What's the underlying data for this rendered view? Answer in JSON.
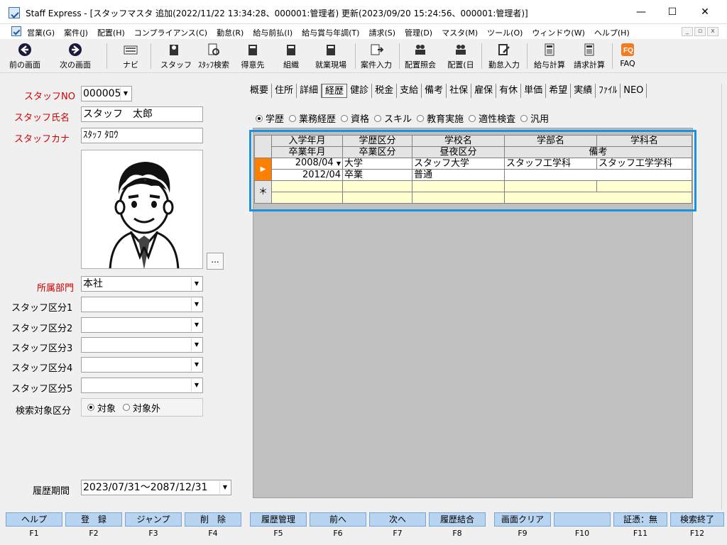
{
  "window": {
    "title": "Staff Express - [スタッフマスタ 追加(2022/11/22 13:34:28、000001:管理者) 更新(2023/09/20 15:24:56、000001:管理者)]",
    "minimize": "—",
    "maximize": "☐",
    "close": "✕"
  },
  "menu": [
    "営業(G)",
    "案件(J)",
    "配置(H)",
    "コンプライアンス(C)",
    "勤怠(R)",
    "給与前払(I)",
    "給与賞与年調(T)",
    "請求(S)",
    "管理(D)",
    "マスタ(M)",
    "ツール(O)",
    "ウィンドウ(W)",
    "ヘルプ(H)"
  ],
  "toolbar": {
    "back": "前の画面",
    "next": "次の画面",
    "navi": "ナビ",
    "staff": "スタッフ",
    "staff_search": "ｽﾀｯﾌ検索",
    "client": "得意先",
    "org": "組織",
    "site": "就業現場",
    "case_input": "案件入力",
    "placement_inquiry": "配置照会",
    "placement_day": "配置(日",
    "attendance_input": "勤怠入力",
    "payroll_calc": "給与計算",
    "billing_calc": "請求計算",
    "faq": "FAQ"
  },
  "left": {
    "staff_no_label": "スタッフNO",
    "staff_no_value": "000005",
    "staff_name_label": "スタッフ氏名",
    "staff_name_value": "スタッフ　太郎",
    "staff_kana_label": "スタッフカナ",
    "staff_kana_value": "ｽﾀｯﾌ ﾀﾛｳ",
    "photo_button": "...",
    "dept_label": "所属部門",
    "dept_value": "本社",
    "class1_label": "スタッフ区分1",
    "class2_label": "スタッフ区分2",
    "class3_label": "スタッフ区分3",
    "class4_label": "スタッフ区分4",
    "class5_label": "スタッフ区分5",
    "search_target_label": "検索対象区分",
    "search_target_on": "対象",
    "search_target_off": "対象外",
    "history_label": "履歴期間",
    "history_value": "2023/07/31～2087/12/31"
  },
  "tabs": [
    "概要",
    "住所",
    "詳細",
    "経歴",
    "健診",
    "税金",
    "支給",
    "備考",
    "社保",
    "雇保",
    "有休",
    "単価",
    "希望",
    "実績",
    "ﾌｧｲﾙ",
    "NEO"
  ],
  "active_tab_index": 3,
  "radios": [
    "学歴",
    "業務経歴",
    "資格",
    "スキル",
    "教育実施",
    "適性検査",
    "汎用"
  ],
  "radio_selected": 0,
  "grid": {
    "headers1": [
      "入学年月",
      "学歴区分",
      "学校名",
      "学部名",
      "学科名"
    ],
    "headers2": [
      "卒業年月",
      "卒業区分",
      "昼夜区分",
      "備考"
    ],
    "row": {
      "entry_date": "2008/04",
      "edu_class": "大学",
      "school": "スタッフ大学",
      "faculty": "スタッフ工学科",
      "department": "スタッフ工学学科",
      "grad_date": "2012/04",
      "grad_class": "卒業",
      "day_night": "普通",
      "remarks": ""
    },
    "new_row_marker": "＊",
    "current_row_marker": "▶"
  },
  "fn_buttons": [
    {
      "label": "ヘルプ",
      "key": "F1"
    },
    {
      "label": "登　録",
      "key": "F2"
    },
    {
      "label": "ジャンプ",
      "key": "F3"
    },
    {
      "label": "削　除",
      "key": "F4"
    },
    {
      "label": "履歴管理",
      "key": "F5"
    },
    {
      "label": "前へ",
      "key": "F6"
    },
    {
      "label": "次へ",
      "key": "F7"
    },
    {
      "label": "履歴結合",
      "key": "F8"
    },
    {
      "label": "画面クリア",
      "key": "F9"
    },
    {
      "label": "",
      "key": "F10"
    },
    {
      "label": "証憑：無",
      "key": "F11"
    },
    {
      "label": "検索終了",
      "key": "F12"
    }
  ],
  "colors": {
    "accent": "#1e90e0",
    "required_label": "#d00000",
    "fn_button": "#b8d4f0",
    "current_row": "#ff8000",
    "new_row": "#ffffd0"
  }
}
